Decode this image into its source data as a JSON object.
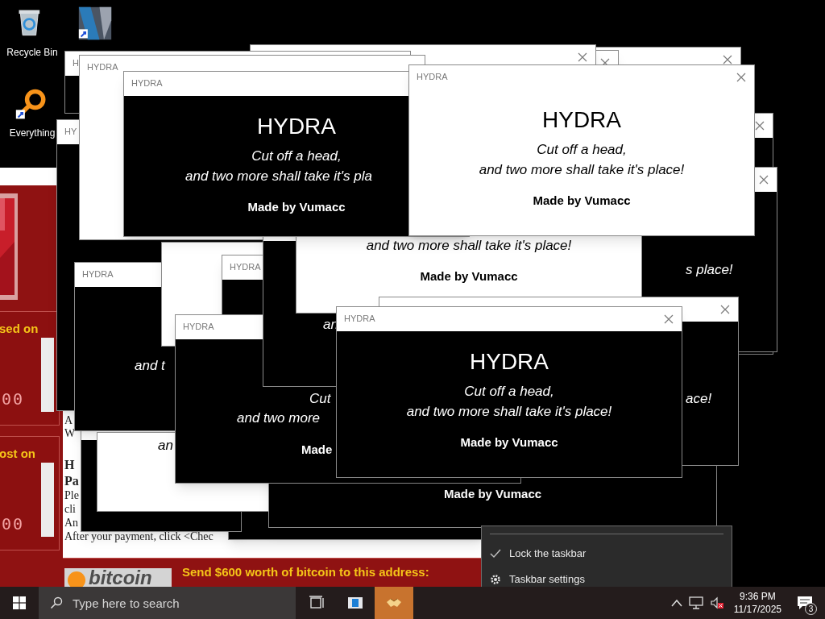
{
  "desktop_icons": [
    {
      "kind": "bin",
      "label": "Recycle Bin"
    },
    {
      "kind": "video"
    },
    {
      "kind": "search",
      "label": "Everything"
    }
  ],
  "ransom_window": {
    "timer_labels": [
      "sed on",
      "ost on"
    ],
    "timers": [
      "00",
      "00"
    ],
    "text_fragments": [
      {
        "text": "A",
        "bold": false
      },
      {
        "text": "W",
        "bold": false
      },
      {
        "text": "H",
        "bold": true
      },
      {
        "text": "Pa",
        "bold": true
      },
      {
        "text": "Ple",
        "bold": false
      },
      {
        "text": "cli",
        "bold": false
      },
      {
        "text": "An",
        "bold": false
      },
      {
        "text": "After your payment, click <Chec",
        "bold": false
      }
    ],
    "logo_text": "bitcoin",
    "payment_prompt": "Send $600 worth of bitcoin to this address:"
  },
  "popups": [
    {
      "kind": "light",
      "close": true
    },
    {
      "kind": "light",
      "close": true
    },
    {
      "kind": "light",
      "close": true
    },
    {
      "kind": "dark",
      "close": true
    },
    {
      "kind": "dark",
      "close": true,
      "line_2": "s place!"
    },
    {
      "kind": "dark"
    },
    {
      "kind": "dark",
      "title": "H"
    },
    {
      "kind": "dark",
      "title": "HY"
    },
    {
      "kind": "light",
      "title": "HYDRA"
    },
    {
      "kind": "dark"
    },
    {
      "kind": "dark",
      "title": "HYDRA",
      "line_2": "and t"
    },
    {
      "kind": "light",
      "line_2": "an"
    },
    {
      "kind": "light"
    },
    {
      "kind": "dark",
      "title": "HYDRA"
    },
    {
      "kind": "dark",
      "credit": "Made by Vumacc"
    },
    {
      "kind": "dark",
      "title": "HYDRA",
      "line_1": "Cut",
      "line_2": "and two more",
      "credit": "Made"
    },
    {
      "kind": "dark",
      "line_2": "an"
    },
    {
      "kind": "light",
      "line_2": "and two more shall take it's place!",
      "credit": "Made by Vumacc"
    },
    {
      "kind": "dark",
      "title": "HYDRA",
      "heading": "HYDRA",
      "line_1": "Cut off a head,",
      "line_2": "and two more shall take it's pla",
      "credit": "Made by Vumacc"
    },
    {
      "kind": "dark",
      "close": true,
      "line_2": "ace!"
    },
    {
      "kind": "light",
      "title": "HYDRA",
      "close": true,
      "heading": "HYDRA",
      "line_1": "Cut off a head,",
      "line_2": "and two more shall take it's place!",
      "credit": "Made by Vumacc"
    },
    {
      "kind": "dark",
      "title": "HYDRA",
      "close": true,
      "heading": "HYDRA",
      "line_1": "Cut off a head,",
      "line_2": "and two more shall take it's place!",
      "credit": "Made by Vumacc"
    }
  ],
  "context_menu": {
    "items": [
      {
        "kind": "toggle",
        "label": "Lock the taskbar",
        "checked": true
      },
      {
        "kind": "settings",
        "label": "Taskbar settings"
      }
    ]
  },
  "taskbar": {
    "search": {
      "placeholder": "Type here to search"
    },
    "apps": [
      {
        "kind": "task-view",
        "selected": false
      },
      {
        "kind": "window",
        "selected": false
      },
      {
        "kind": "handshake",
        "selected": true
      }
    ],
    "time": "9:36 PM",
    "date": "11/17/2025",
    "notification_count": "3"
  }
}
